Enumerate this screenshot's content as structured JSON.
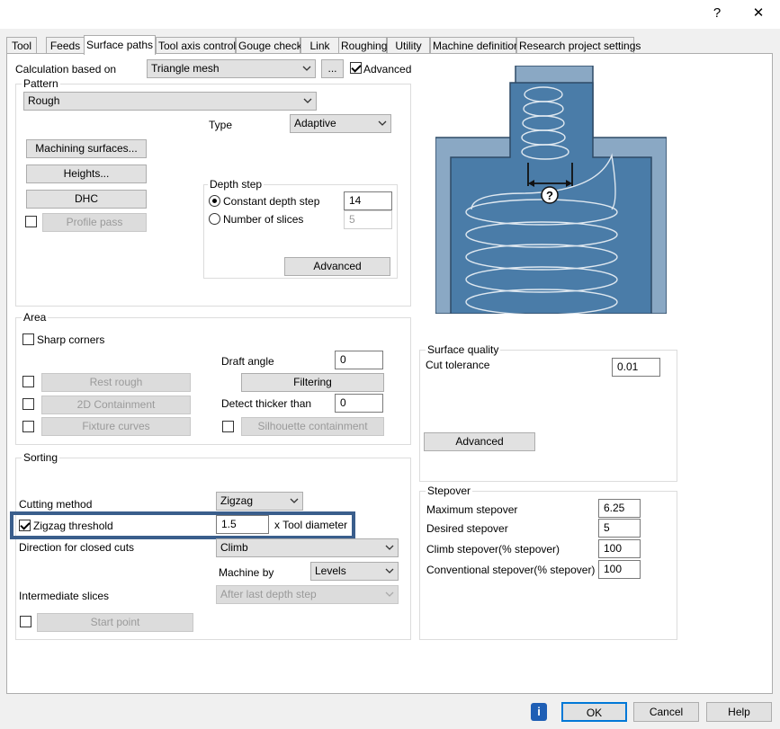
{
  "window": {
    "help_glyph": "?",
    "close_glyph": "✕"
  },
  "tabs": [
    {
      "label": "Tool"
    },
    {
      "label": "Feeds"
    },
    {
      "label": "Surface paths"
    },
    {
      "label": "Tool axis control"
    },
    {
      "label": "Gouge check"
    },
    {
      "label": "Link"
    },
    {
      "label": "Roughing"
    },
    {
      "label": "Utility"
    },
    {
      "label": "Machine definition"
    },
    {
      "label": "Research project settings"
    }
  ],
  "active_tab": "Surface paths",
  "calc": {
    "label": "Calculation based on",
    "value": "Triangle mesh",
    "ellipsis": "...",
    "advanced_label": "Advanced",
    "advanced_checked": true
  },
  "pattern": {
    "group_label": "Pattern",
    "value": "Rough",
    "type_label": "Type",
    "type_value": "Adaptive",
    "machining_surfaces": "Machining surfaces...",
    "heights": "Heights...",
    "dhc": "DHC",
    "profile_pass": "Profile pass",
    "profile_checked": false,
    "depth_step": {
      "group_label": "Depth step",
      "constant_label": "Constant depth step",
      "constant_value": "14",
      "slices_label": "Number of slices",
      "slices_value": "5",
      "selected": "constant",
      "advanced": "Advanced"
    }
  },
  "area": {
    "group_label": "Area",
    "sharp_corners": "Sharp corners",
    "sharp_checked": false,
    "rest_rough": "Rest rough",
    "containment_2d": "2D Containment",
    "fixture_curves": "Fixture curves",
    "draft_angle_label": "Draft angle",
    "draft_angle_value": "0",
    "filtering": "Filtering",
    "detect_thicker_label": "Detect thicker than",
    "detect_thicker_value": "0",
    "silhouette": "Silhouette containment"
  },
  "surface_quality": {
    "group_label": "Surface quality",
    "cut_tolerance_label": "Cut tolerance",
    "cut_tolerance_value": "0.01",
    "advanced": "Advanced"
  },
  "sorting": {
    "group_label": "Sorting",
    "cutting_method_label": "Cutting method",
    "cutting_method_value": "Zigzag",
    "zigzag_threshold_label": "Zigzag threshold",
    "zigzag_threshold_checked": true,
    "zigzag_threshold_value": "1.5",
    "zigzag_unit": "x Tool diameter",
    "direction_label": "Direction for closed cuts",
    "direction_value": "Climb",
    "machine_by_label": "Machine by",
    "machine_by_value": "Levels",
    "intermediate_label": "Intermediate slices",
    "intermediate_value": "After last depth step",
    "start_point": "Start point"
  },
  "stepover": {
    "group_label": "Stepover",
    "max_label": "Maximum stepover",
    "max_value": "6.25",
    "desired_label": "Desired stepover",
    "desired_value": "5",
    "climb_label": "Climb stepover(% stepover)",
    "climb_value": "100",
    "conv_label": "Conventional stepover(% stepover)",
    "conv_value": "100"
  },
  "illustration": {
    "marker": "?",
    "colors": {
      "outer": "#8aa8c4",
      "inner": "#4a7ca8",
      "stroke": "#2e4a66",
      "path": "#dfe8f0"
    }
  },
  "footer": {
    "info_icon": "i",
    "ok": "OK",
    "cancel": "Cancel",
    "help": "Help"
  }
}
